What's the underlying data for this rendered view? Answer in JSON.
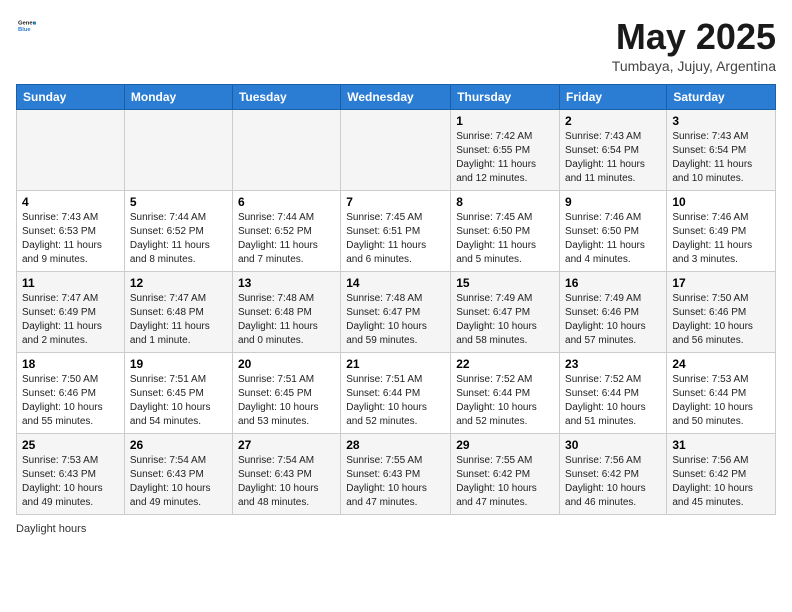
{
  "header": {
    "logo_line1": "General",
    "logo_line2": "Blue",
    "title": "May 2025",
    "subtitle": "Tumbaya, Jujuy, Argentina"
  },
  "days_of_week": [
    "Sunday",
    "Monday",
    "Tuesday",
    "Wednesday",
    "Thursday",
    "Friday",
    "Saturday"
  ],
  "weeks": [
    [
      {
        "day": "",
        "info": ""
      },
      {
        "day": "",
        "info": ""
      },
      {
        "day": "",
        "info": ""
      },
      {
        "day": "",
        "info": ""
      },
      {
        "day": "1",
        "info": "Sunrise: 7:42 AM\nSunset: 6:55 PM\nDaylight: 11 hours and 12 minutes."
      },
      {
        "day": "2",
        "info": "Sunrise: 7:43 AM\nSunset: 6:54 PM\nDaylight: 11 hours and 11 minutes."
      },
      {
        "day": "3",
        "info": "Sunrise: 7:43 AM\nSunset: 6:54 PM\nDaylight: 11 hours and 10 minutes."
      }
    ],
    [
      {
        "day": "4",
        "info": "Sunrise: 7:43 AM\nSunset: 6:53 PM\nDaylight: 11 hours and 9 minutes."
      },
      {
        "day": "5",
        "info": "Sunrise: 7:44 AM\nSunset: 6:52 PM\nDaylight: 11 hours and 8 minutes."
      },
      {
        "day": "6",
        "info": "Sunrise: 7:44 AM\nSunset: 6:52 PM\nDaylight: 11 hours and 7 minutes."
      },
      {
        "day": "7",
        "info": "Sunrise: 7:45 AM\nSunset: 6:51 PM\nDaylight: 11 hours and 6 minutes."
      },
      {
        "day": "8",
        "info": "Sunrise: 7:45 AM\nSunset: 6:50 PM\nDaylight: 11 hours and 5 minutes."
      },
      {
        "day": "9",
        "info": "Sunrise: 7:46 AM\nSunset: 6:50 PM\nDaylight: 11 hours and 4 minutes."
      },
      {
        "day": "10",
        "info": "Sunrise: 7:46 AM\nSunset: 6:49 PM\nDaylight: 11 hours and 3 minutes."
      }
    ],
    [
      {
        "day": "11",
        "info": "Sunrise: 7:47 AM\nSunset: 6:49 PM\nDaylight: 11 hours and 2 minutes."
      },
      {
        "day": "12",
        "info": "Sunrise: 7:47 AM\nSunset: 6:48 PM\nDaylight: 11 hours and 1 minute."
      },
      {
        "day": "13",
        "info": "Sunrise: 7:48 AM\nSunset: 6:48 PM\nDaylight: 11 hours and 0 minutes."
      },
      {
        "day": "14",
        "info": "Sunrise: 7:48 AM\nSunset: 6:47 PM\nDaylight: 10 hours and 59 minutes."
      },
      {
        "day": "15",
        "info": "Sunrise: 7:49 AM\nSunset: 6:47 PM\nDaylight: 10 hours and 58 minutes."
      },
      {
        "day": "16",
        "info": "Sunrise: 7:49 AM\nSunset: 6:46 PM\nDaylight: 10 hours and 57 minutes."
      },
      {
        "day": "17",
        "info": "Sunrise: 7:50 AM\nSunset: 6:46 PM\nDaylight: 10 hours and 56 minutes."
      }
    ],
    [
      {
        "day": "18",
        "info": "Sunrise: 7:50 AM\nSunset: 6:46 PM\nDaylight: 10 hours and 55 minutes."
      },
      {
        "day": "19",
        "info": "Sunrise: 7:51 AM\nSunset: 6:45 PM\nDaylight: 10 hours and 54 minutes."
      },
      {
        "day": "20",
        "info": "Sunrise: 7:51 AM\nSunset: 6:45 PM\nDaylight: 10 hours and 53 minutes."
      },
      {
        "day": "21",
        "info": "Sunrise: 7:51 AM\nSunset: 6:44 PM\nDaylight: 10 hours and 52 minutes."
      },
      {
        "day": "22",
        "info": "Sunrise: 7:52 AM\nSunset: 6:44 PM\nDaylight: 10 hours and 52 minutes."
      },
      {
        "day": "23",
        "info": "Sunrise: 7:52 AM\nSunset: 6:44 PM\nDaylight: 10 hours and 51 minutes."
      },
      {
        "day": "24",
        "info": "Sunrise: 7:53 AM\nSunset: 6:44 PM\nDaylight: 10 hours and 50 minutes."
      }
    ],
    [
      {
        "day": "25",
        "info": "Sunrise: 7:53 AM\nSunset: 6:43 PM\nDaylight: 10 hours and 49 minutes."
      },
      {
        "day": "26",
        "info": "Sunrise: 7:54 AM\nSunset: 6:43 PM\nDaylight: 10 hours and 49 minutes."
      },
      {
        "day": "27",
        "info": "Sunrise: 7:54 AM\nSunset: 6:43 PM\nDaylight: 10 hours and 48 minutes."
      },
      {
        "day": "28",
        "info": "Sunrise: 7:55 AM\nSunset: 6:43 PM\nDaylight: 10 hours and 47 minutes."
      },
      {
        "day": "29",
        "info": "Sunrise: 7:55 AM\nSunset: 6:42 PM\nDaylight: 10 hours and 47 minutes."
      },
      {
        "day": "30",
        "info": "Sunrise: 7:56 AM\nSunset: 6:42 PM\nDaylight: 10 hours and 46 minutes."
      },
      {
        "day": "31",
        "info": "Sunrise: 7:56 AM\nSunset: 6:42 PM\nDaylight: 10 hours and 45 minutes."
      }
    ]
  ],
  "footer": {
    "text": "Daylight hours"
  }
}
